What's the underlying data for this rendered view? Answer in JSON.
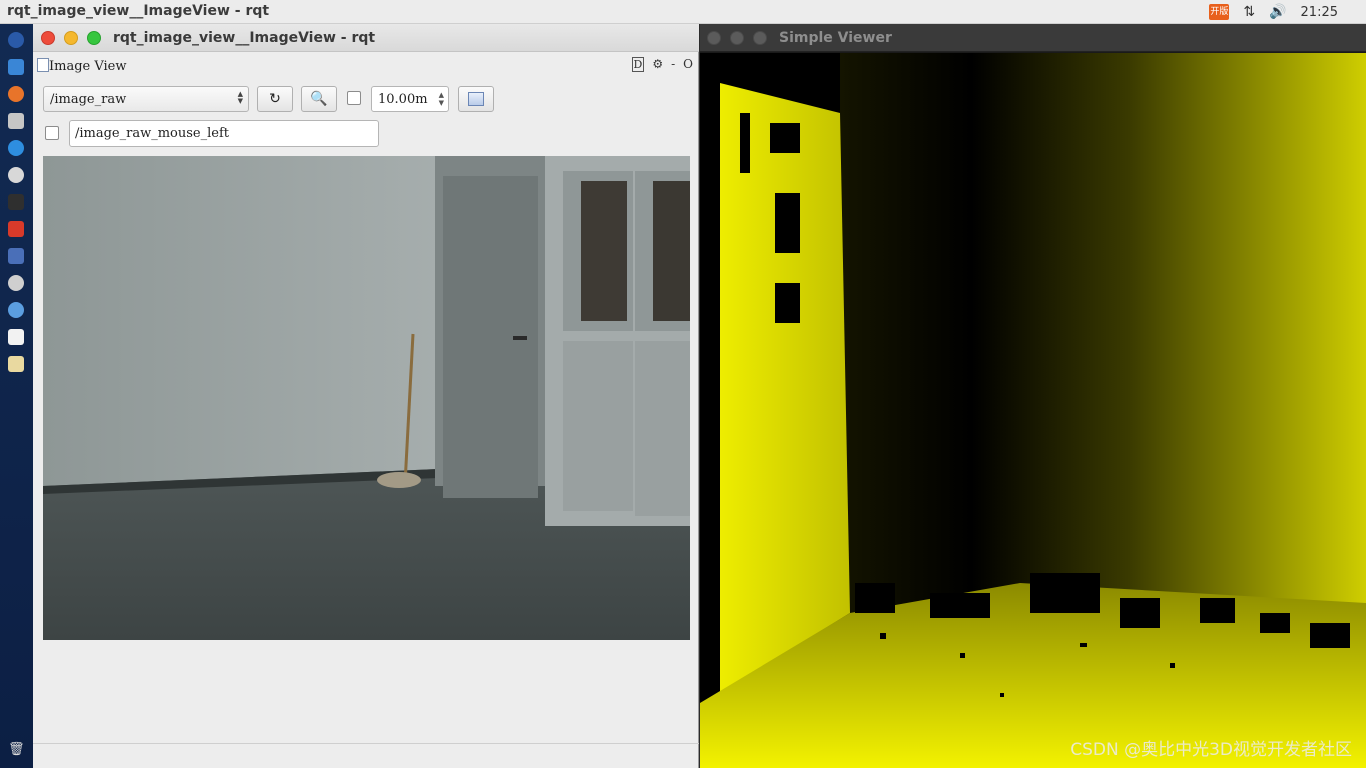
{
  "top_panel": {
    "title": "rqt_image_view__ImageView - rqt",
    "ime_label": "开版",
    "clock": "21:25"
  },
  "launcher": {
    "icons": [
      "ubuntu-dash-icon",
      "files-icon",
      "firefox-icon",
      "software-center-icon",
      "app-store-icon",
      "settings-icon",
      "terminal-icon",
      "presentation-icon",
      "workspace-icon",
      "compass-icon",
      "globe-icon",
      "document-icon",
      "notes-icon",
      "trash-icon"
    ]
  },
  "rqt": {
    "window_title": "rqt_image_view__ImageView - rqt",
    "plugin_label": "Image View",
    "plugin_controls": [
      "D",
      "⚙",
      "-",
      "O"
    ],
    "topic_combo": "/image_raw",
    "max_range": "10.00m",
    "mouse_topic": "/image_raw_mouse_left"
  },
  "simple_viewer": {
    "window_title": "Simple Viewer",
    "watermark": "CSDN @奥比中光3D视觉开发者社区"
  },
  "colors": {
    "depth_yellow": "#f0ef00",
    "close_red": "#ee4c3b",
    "min_yellow": "#f5b82e",
    "max_green": "#37c63f",
    "launcher_blue": "#122a52"
  }
}
